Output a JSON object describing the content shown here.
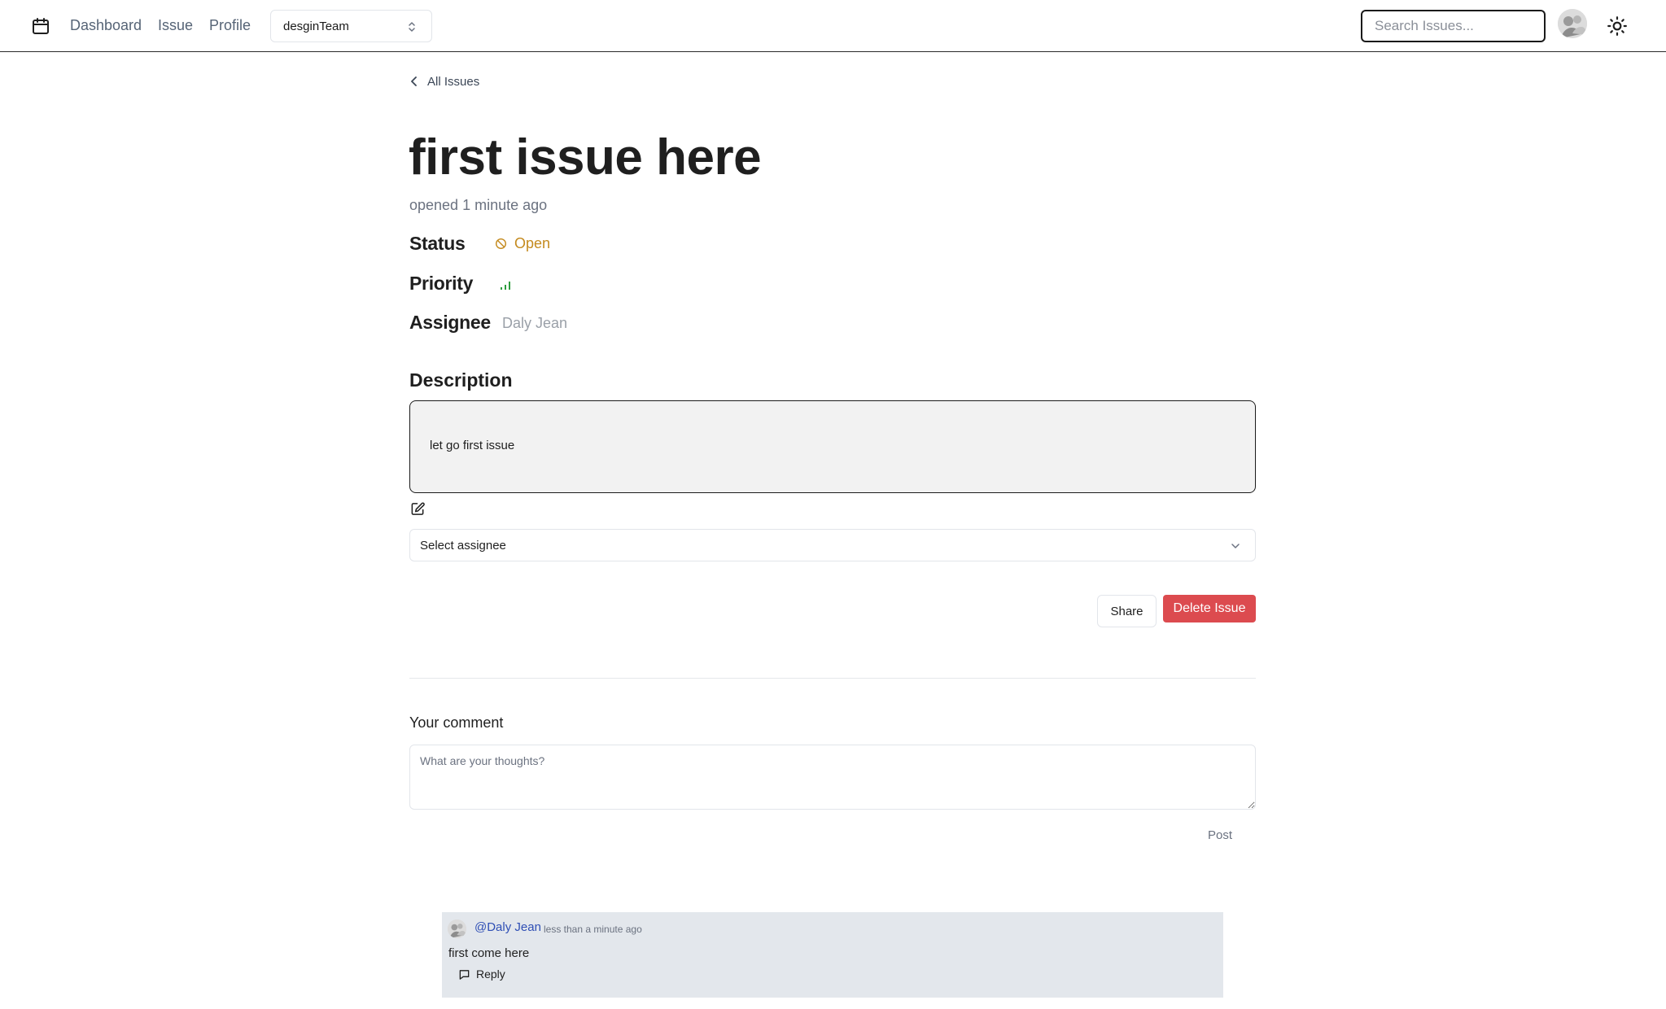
{
  "nav": {
    "links": [
      {
        "label": "Dashboard"
      },
      {
        "label": "Issue"
      },
      {
        "label": "Profile"
      }
    ],
    "team_select": {
      "value": "desginTeam"
    },
    "search": {
      "placeholder": "Search Issues..."
    },
    "icons": {
      "logo": "calendar-box-icon",
      "theme": "sun-icon",
      "chevron": "chevron-up-down-icon"
    }
  },
  "issue": {
    "back_label": "All Issues",
    "title": "first issue here",
    "opened": "opened 1 minute ago",
    "status_label": "Status",
    "status_value": "Open",
    "priority_label": "Priority",
    "priority_level": "low",
    "assignee_label": "Assignee",
    "assignee_value": "Daly Jean",
    "description_heading": "Description",
    "description_text": "let go first issue",
    "assignee_select_placeholder": "Select assignee",
    "share_label": "Share",
    "delete_label": "Delete Issue"
  },
  "comments": {
    "label": "Your comment",
    "placeholder": "What are your thoughts?",
    "post_label": "Post",
    "items": [
      {
        "author": "@Daly Jean",
        "time": "less than a minute ago",
        "body": "first come here",
        "reply_label": "Reply"
      }
    ]
  },
  "colors": {
    "status_open": "#c48a1e",
    "priority_low": "#2e9d3f",
    "delete_button": "#dc4b4f",
    "comment_author": "#2f4fb5",
    "comment_bg": "#e3e7ec"
  }
}
